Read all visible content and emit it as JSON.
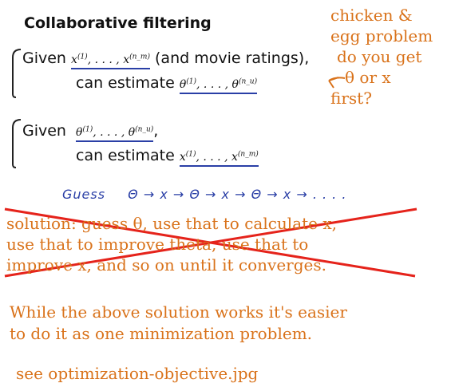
{
  "title": "Collaborative filtering",
  "note_lines": [
    "chicken &",
    "egg problem",
    "do you get",
    "θ or x",
    "first?"
  ],
  "block1": {
    "given": "Given",
    "given_rest": "(and movie ratings),",
    "estimate": "can estimate",
    "x_first": "x",
    "x_first_sup": "(1)",
    "x_last": "x",
    "x_last_sup": "(n_m)",
    "theta_first": "θ",
    "theta_first_sup": "(1)",
    "theta_last": "θ",
    "theta_last_sup": "(n_u)",
    "ellipsis": ", . . . , "
  },
  "block2": {
    "given": "Given",
    "estimate": "can estimate",
    "comma": ","
  },
  "handwriting": {
    "label": "Guess",
    "sequence": "Θ → x → Θ → x → Θ → x → . . . ."
  },
  "solution_lines": [
    "solution: guess θ, use that to calculate x,",
    "use that to improve theta, use that to",
    "improve x, and so on until it converges."
  ],
  "paragraph_lines": [
    "While the above solution works it's easier",
    "to do it as one minimization problem."
  ],
  "see_note": "see optimization-objective.jpg",
  "colors": {
    "orange_text": "#d9721a",
    "strike_red": "#e5231b",
    "ink_blue": "#2a3fa6"
  }
}
